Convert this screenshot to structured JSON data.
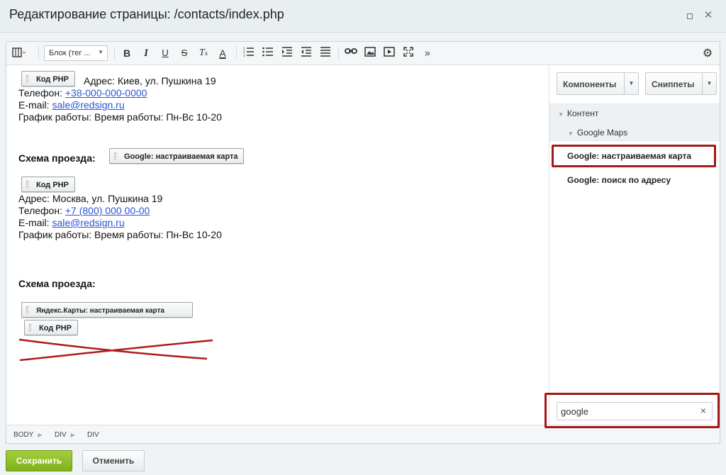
{
  "window": {
    "title": "Редактирование страницы: /contacts/index.php"
  },
  "toolbar": {
    "block_select": "Блок (тег ...",
    "bold": "B",
    "italic": "I",
    "underline": "U",
    "strike": "S",
    "clear_format": "T",
    "font_color": "A",
    "more": "»"
  },
  "content": {
    "chip_php_1": "Код PHP",
    "address_1": "Адрес: Киев, ул. Пушкина 19",
    "phone_label_1": "Телефон: ",
    "phone_1": "+38-000-000-0000",
    "email_label_1": "E-mail: ",
    "email_1": "sale@redsign.ru",
    "hours_1": "График работы: Время работы: Пн-Вс 10-20",
    "route_label_1": "Схема проезда:",
    "chip_google_map": "Google: настраиваемая карта",
    "chip_php_2": "Код PHP",
    "address_2": "Адрес: Москва, ул. Пушкина 19",
    "phone_label_2": "Телефон: ",
    "phone_2": "+7 (800) 000 00-00",
    "email_label_2": "E-mail: ",
    "email_2": "sale@redsign.ru",
    "hours_2": "График работы: Время работы: Пн-Вс 10-20",
    "route_label_2": "Схема проезда:",
    "chip_yandex_map": "Яндекс.Карты: настраиваемая карта",
    "chip_php_3": "Код PHP"
  },
  "sidebar": {
    "components_button": "Компоненты",
    "snippets_button": "Сниппеты",
    "tree_content": "Контент",
    "tree_google_maps": "Google Maps",
    "items": [
      "Google: настраиваемая карта",
      "Google: поиск по адресу"
    ],
    "search_value": "google",
    "search_clear": "×"
  },
  "statusbar": {
    "crumbs": [
      "BODY",
      "DIV",
      "DIV"
    ]
  },
  "footer": {
    "save_label": "Сохранить",
    "cancel_label": "Отменить"
  },
  "colors": {
    "highlight": "#a31818",
    "save_green": "#8dbd24",
    "link": "#2a55d6"
  }
}
